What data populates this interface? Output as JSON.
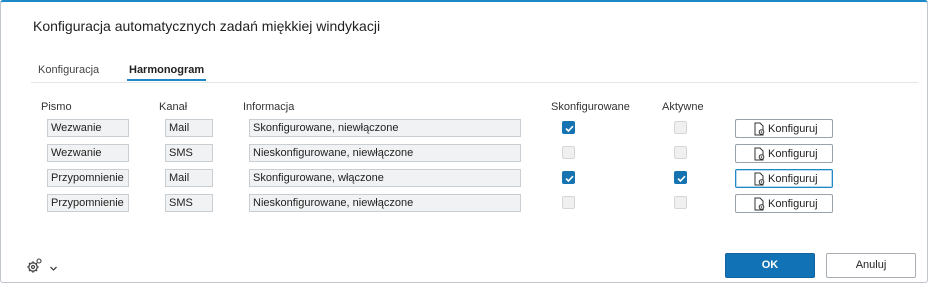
{
  "dialog": {
    "title": "Konfiguracja automatycznych zadań miękkiej windykacji"
  },
  "tabs": [
    {
      "label": "Konfiguracja",
      "active": false
    },
    {
      "label": "Harmonogram",
      "active": true
    }
  ],
  "columns": {
    "letter": "Pismo",
    "channel": "Kanał",
    "info": "Informacja",
    "configured": "Skonfigurowane",
    "active": "Aktywne"
  },
  "rows": [
    {
      "letter": "Wezwanie",
      "channel": "Mail",
      "info": "Skonfigurowane, niewłączone",
      "configured": true,
      "active": false,
      "button": "Konfiguruj"
    },
    {
      "letter": "Wezwanie",
      "channel": "SMS",
      "info": "Nieskonfigurowane, niewłączone",
      "configured": false,
      "active": false,
      "button": "Konfiguruj"
    },
    {
      "letter": "Przypomnienie",
      "channel": "Mail",
      "info": "Skonfigurowane, włączone",
      "configured": true,
      "active": true,
      "button": "Konfiguruj"
    },
    {
      "letter": "Przypomnienie",
      "channel": "SMS",
      "info": "Nieskonfigurowane, niewłączone",
      "configured": false,
      "active": false,
      "button": "Konfiguruj"
    }
  ],
  "footer": {
    "settings_icon": "gear-icon",
    "menu_icon": "chevron-down-icon",
    "ok_label": "OK",
    "cancel_label": "Anuluj"
  },
  "colors": {
    "accent": "#1e88c7",
    "primary_button": "#1272b6",
    "checkbox_checked": "#1673b1"
  }
}
